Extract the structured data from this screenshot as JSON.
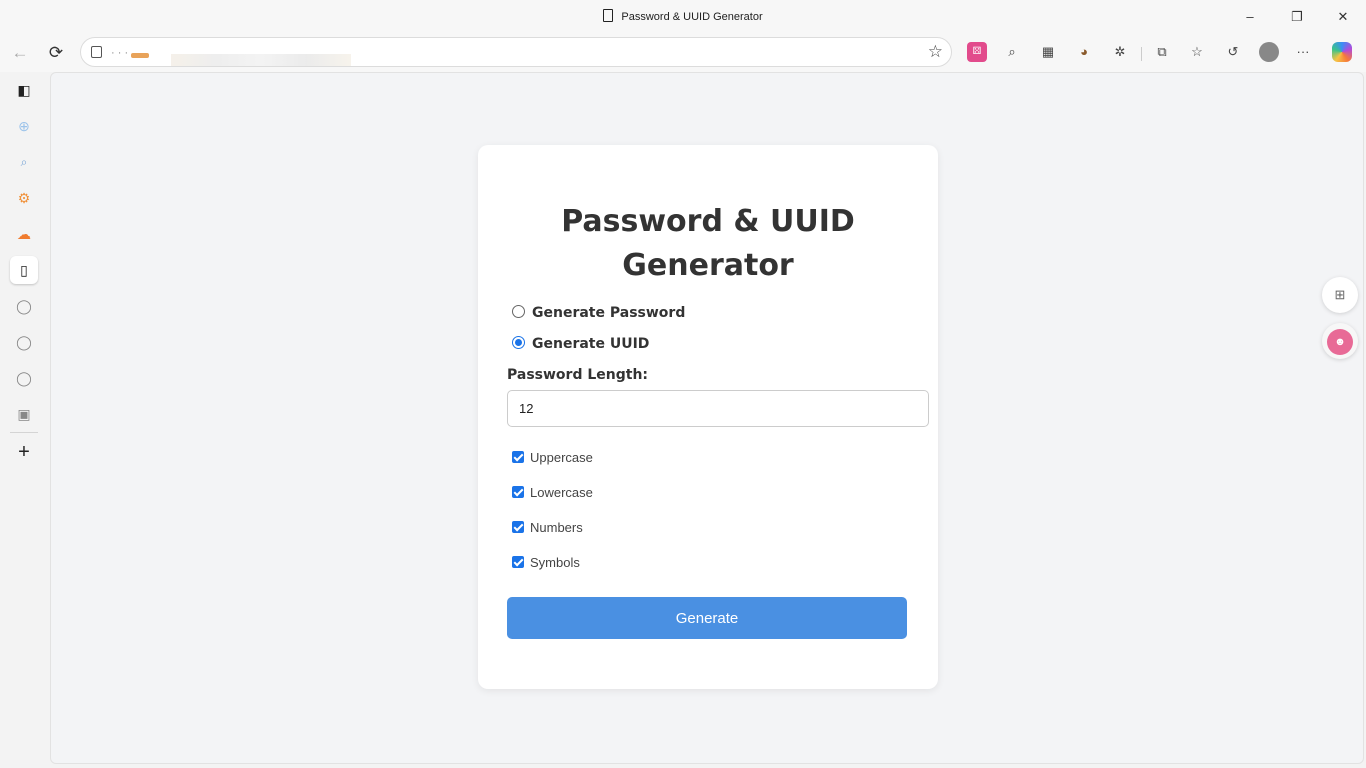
{
  "window": {
    "title": "Password & UUID Generator",
    "minimize": "–",
    "restore": "❐",
    "close": "✕"
  },
  "nav": {
    "back": "←",
    "reload": "⟳",
    "url": "· · ·",
    "favorite": "☆",
    "ext_pink": "⚄",
    "ext_search": "⌕",
    "ext_tab": "▦",
    "ext_cookie": "◕",
    "ext_puzzle": "✲",
    "ext_split": "⧉",
    "ext_favs": "☆",
    "ext_history": "↺",
    "ext_more": "···"
  },
  "sidebar": {
    "items": [
      "◧",
      "⊕",
      "⌕",
      "⚙",
      "☁",
      "▯",
      "◯",
      "◯",
      "◯",
      "▣"
    ],
    "add": "+"
  },
  "app": {
    "heading": "Password & UUID Generator",
    "mode_options": [
      {
        "label": "Generate Password",
        "selected": false
      },
      {
        "label": "Generate UUID",
        "selected": true
      }
    ],
    "length_label": "Password Length:",
    "length_value": "12",
    "options": [
      {
        "label": "Uppercase",
        "checked": true
      },
      {
        "label": "Lowercase",
        "checked": true
      },
      {
        "label": "Numbers",
        "checked": true
      },
      {
        "label": "Symbols",
        "checked": true
      }
    ],
    "generate_label": "Generate"
  },
  "floating": {
    "apps": "⊞",
    "assistant": "☻"
  },
  "colors": {
    "accent": "#4a90e2",
    "check": "#1a73e8",
    "heading": "#333333"
  }
}
